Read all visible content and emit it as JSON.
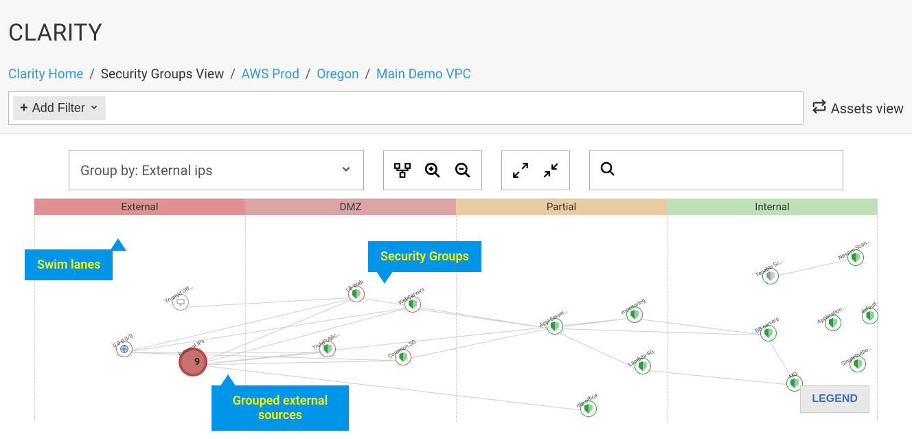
{
  "header": {
    "title": "CLARITY",
    "breadcrumb": {
      "home": "Clarity Home",
      "view": "Security Groups View",
      "account": "AWS Prod",
      "region": "Oregon",
      "vpc": "Main Demo VPC"
    },
    "add_filter": "Add Filter",
    "assets_view": "Assets view"
  },
  "toolbar": {
    "group_by_label": "Group by: External ips"
  },
  "lanes": {
    "external": "External",
    "dmz": "DMZ",
    "partial": "Partial",
    "internal": "Internal"
  },
  "callouts": {
    "swim_lanes": "Swim lanes",
    "security_groups": "Security Groups",
    "grouped_sources": "Grouped external sources"
  },
  "legend_label": "LEGEND",
  "external_ips_count": "9",
  "nodes": {
    "trusted_off": "Trusted Off…",
    "zero_cidr": "0.0.0.0/0",
    "external_ips": "External IPs",
    "lb_web": "LB-Web",
    "webservers": "WebServers",
    "truly_public": "TrulyPublic…",
    "common_sg": "Common SG",
    "appl_server": "Appl Server…",
    "monitoring": "monitoring",
    "lambda_sg": "Lambda-SG",
    "rdp_office": "rdp-office",
    "nessus_scan": "Nessus Scan…",
    "tenable_sc": "Tenable Sc…",
    "db_servers": "DB servers",
    "application": "Application…",
    "default": "default",
    "single_outbo": "SingleOutbo…",
    "mq": "MQ"
  }
}
